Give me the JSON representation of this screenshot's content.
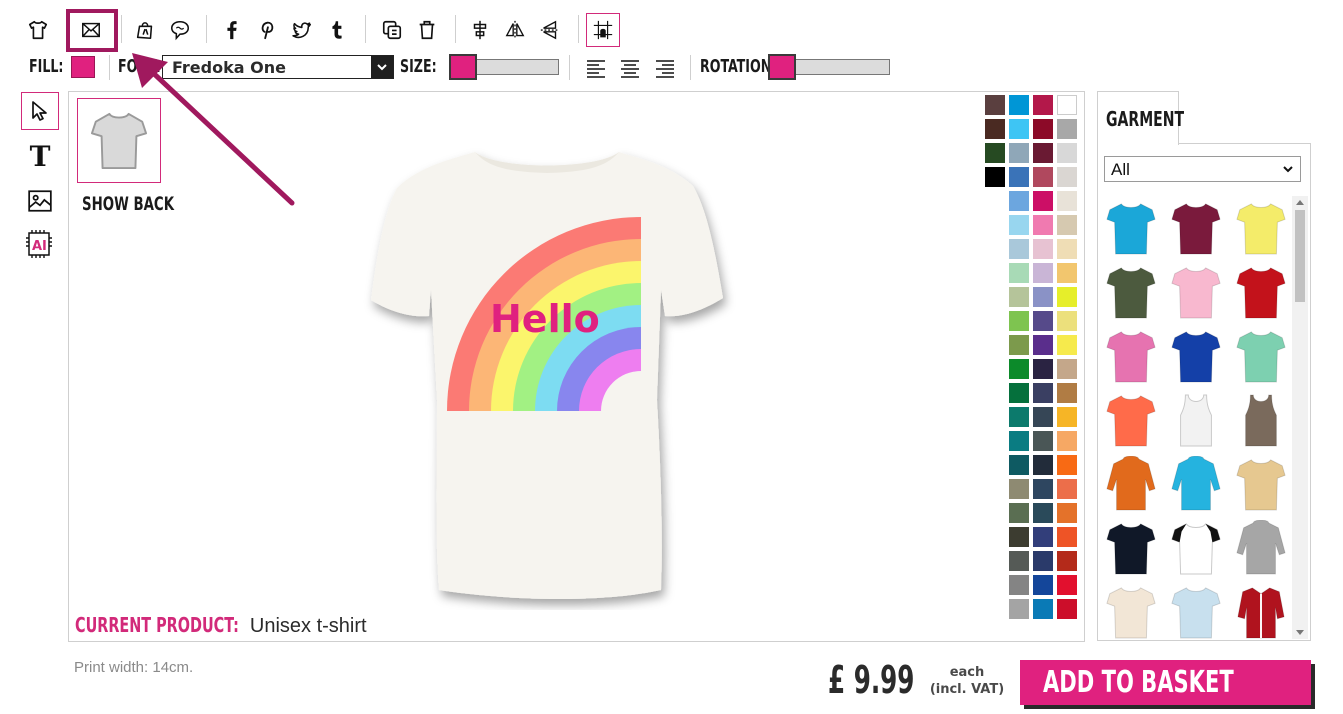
{
  "toolbar": {
    "icons": [
      "tshirt-icon",
      "envelope-icon",
      "shopping-bag-icon",
      "chat-bubble-icon",
      "facebook-icon",
      "pinterest-icon",
      "twitter-icon",
      "tumblr-icon",
      "duplicate-icon",
      "trash-icon",
      "align-center-icon",
      "flip-horizontal-icon",
      "flip-vertical-icon",
      "grid-snap-icon"
    ],
    "highlight_color": "#a0195e"
  },
  "props": {
    "fill_label": "FILL:",
    "fill_color": "#e0217f",
    "font_label": "FONT:",
    "font_value": "Fredoka One",
    "size_label": "SIZE:",
    "size_level": 0.05,
    "rotation_label": "ROTATION:",
    "rotation_level": 0.05
  },
  "tools": [
    "select-pointer-icon",
    "text-tool-icon",
    "image-tool-icon",
    "ai-tool-icon"
  ],
  "canvas": {
    "show_back_label": "SHOW BACK",
    "design_text": "Hello",
    "current_product_label": "CURRENT PRODUCT:",
    "current_product_value": "Unisex t-shirt"
  },
  "palette": [
    "#5a3f3f",
    "#0096d6",
    "#b3184a",
    "#ffffff",
    "#4a2a22",
    "#3ec5f4",
    "#8c0a28",
    "#a8a8a8",
    "#264a22",
    "#8fa7b8",
    "#6a1a33",
    "#d8d8d8",
    "#000000",
    "#3a73b8",
    "#b0485e",
    "#dad6d2",
    "",
    "#6ca6df",
    "#cc0f66",
    "#e8e2d8",
    "",
    "#98d6ef",
    "#f07ab0",
    "#d6c9b0",
    "",
    "#a9c8da",
    "#e7c2d2",
    "#efddb5",
    "",
    "#a8dab6",
    "#c9b5d6",
    "#f2c66e",
    "",
    "#b5c49a",
    "#8a92c6",
    "#e6ee2a",
    "",
    "#7ec450",
    "#564a8a",
    "#ece07c",
    "",
    "#7c9a4c",
    "#5a2e8c",
    "#f6ea4c",
    "",
    "#0c8a2a",
    "#2a2342",
    "#c4a78a",
    "",
    "#05703c",
    "#3a3f62",
    "#b07c44",
    "",
    "#0c7a6c",
    "#364656",
    "#f6b526",
    "",
    "#0a7c82",
    "#4a5656",
    "#f6a864",
    "",
    "#0e5a62",
    "#222c3a",
    "#f86a14",
    "",
    "#8e8a72",
    "#2e4660",
    "#ec6e4a",
    "",
    "#5a6e52",
    "#2a4a5a",
    "#e4722a",
    "",
    "#3c3c30",
    "#323e7a",
    "#ee5426",
    "",
    "#555a56",
    "#2a3a6a",
    "#b42a1a",
    "",
    "#848484",
    "#14469a",
    "#e2102e",
    "",
    "#a4a4a4",
    "#0a7ab6",
    "#cc0e2a"
  ],
  "garment": {
    "tab_label": "GARMENT",
    "filter_value": "All",
    "items": [
      {
        "name": "tshirt-turquoise",
        "color": "#1ba7d8",
        "kind": "tee"
      },
      {
        "name": "tshirt-maroon",
        "color": "#7a1a3c",
        "kind": "tee"
      },
      {
        "name": "tshirt-yellow",
        "color": "#f4ec6a",
        "kind": "tee"
      },
      {
        "name": "tshirt-olive",
        "color": "#4c5a3e",
        "kind": "tee"
      },
      {
        "name": "tshirt-pink",
        "color": "#f8b8cf",
        "kind": "tee"
      },
      {
        "name": "tshirt-red",
        "color": "#c3121b",
        "kind": "tee"
      },
      {
        "name": "tshirt-hot-pink",
        "color": "#e673b0",
        "kind": "tee"
      },
      {
        "name": "tshirt-royal-blue",
        "color": "#1440a8",
        "kind": "tee"
      },
      {
        "name": "tshirt-mint",
        "color": "#7dd0b0",
        "kind": "tee"
      },
      {
        "name": "tshirt-coral",
        "color": "#ff6b4a",
        "kind": "tee"
      },
      {
        "name": "vest-white",
        "color": "#f2f2f2",
        "kind": "vest"
      },
      {
        "name": "vest-brown",
        "color": "#7a6a5c",
        "kind": "vest"
      },
      {
        "name": "hoodie-orange",
        "color": "#e16a1c",
        "kind": "hoodie"
      },
      {
        "name": "hoodie-blue",
        "color": "#25b3df",
        "kind": "hoodie"
      },
      {
        "name": "tshirt-tie-dye",
        "color": "#e6c890",
        "kind": "tee"
      },
      {
        "name": "tshirt-navy",
        "color": "#101828",
        "kind": "tee"
      },
      {
        "name": "raglan-black-white",
        "color": "#ffffff",
        "kind": "raglan"
      },
      {
        "name": "hoodie-grey",
        "color": "#a6a6a6",
        "kind": "hoodie"
      },
      {
        "name": "tshirt-natural",
        "color": "#f2e6d6",
        "kind": "tee"
      },
      {
        "name": "tshirt-light-blue",
        "color": "#c8e0ee",
        "kind": "tee"
      },
      {
        "name": "jacket-red",
        "color": "#b0131e",
        "kind": "jacket"
      }
    ]
  },
  "footer": {
    "print_width": "Print width: 14cm.",
    "price": "£ 9.99",
    "each_line1": "each",
    "each_line2": "(incl. VAT)",
    "add_to_basket": "ADD TO BASKET"
  }
}
